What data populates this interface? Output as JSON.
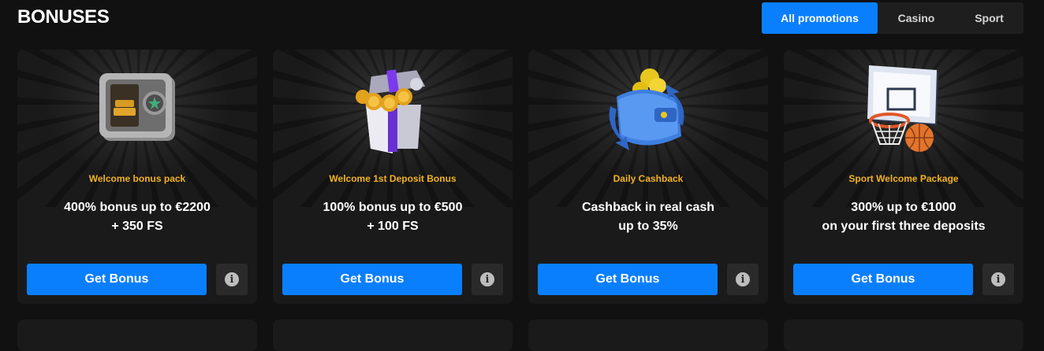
{
  "header": {
    "title": "BONUSES"
  },
  "tabs": [
    {
      "label": "All promotions",
      "active": true
    },
    {
      "label": "Casino",
      "active": false
    },
    {
      "label": "Sport",
      "active": false
    }
  ],
  "cards": [
    {
      "tag": "Welcome bonus pack",
      "title_line1": "400% bonus up to €2200",
      "title_line2": "+ 350 FS",
      "button": "Get Bonus",
      "icon": "safe-icon"
    },
    {
      "tag": "Welcome 1st Deposit Bonus",
      "title_line1": "100% bonus up to €500",
      "title_line2": "+ 100 FS",
      "button": "Get Bonus",
      "icon": "gift-box-icon"
    },
    {
      "tag": "Daily Cashback",
      "title_line1": "Cashback in real cash",
      "title_line2": "up to 35%",
      "button": "Get Bonus",
      "icon": "wallet-icon"
    },
    {
      "tag": "Sport Welcome Package",
      "title_line1": "300% up to €1000",
      "title_line2": "on your first three deposits",
      "button": "Get Bonus",
      "icon": "basketball-hoop-icon"
    }
  ],
  "info_glyph": "i",
  "colors": {
    "accent": "#0a7ffd",
    "tag": "#f2b224",
    "card_bg": "#1a1a1a",
    "page_bg": "#111111"
  }
}
